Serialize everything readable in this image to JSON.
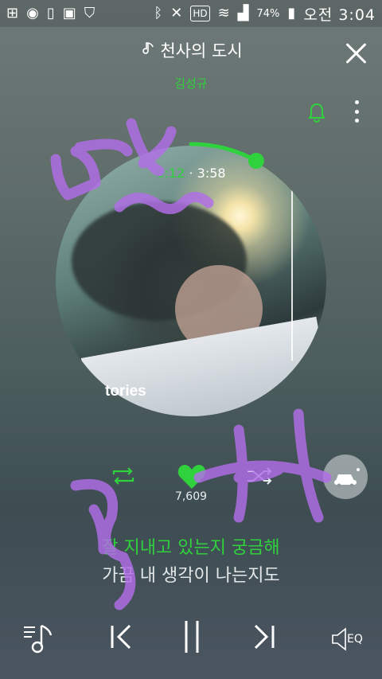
{
  "status_bar": {
    "battery_percent": "74%",
    "time": "오전 3:04",
    "icons": [
      "add-notification-icon",
      "sync-icon",
      "phone-icon",
      "image-icon",
      "shield-icon",
      "bluetooth-icon",
      "mute-icon",
      "hd-icon",
      "wifi-icon",
      "signal-icon",
      "battery-icon"
    ]
  },
  "header": {
    "song_title": "천사의 도시",
    "artist": "김성규"
  },
  "player": {
    "current_time": "0:12",
    "separator": "·",
    "total_time": "3:58",
    "album_text": "tories",
    "like_count": "7,609",
    "progress_fraction": 0.05
  },
  "lyrics": {
    "current": "잘 지내고 있는지 궁금해",
    "next": "가끔 내 생각이 나는지도"
  },
  "bottom_bar": {
    "eq_label": "EQ"
  },
  "colors": {
    "accent": "#2fd23c",
    "scribble": "#b26ee8"
  }
}
